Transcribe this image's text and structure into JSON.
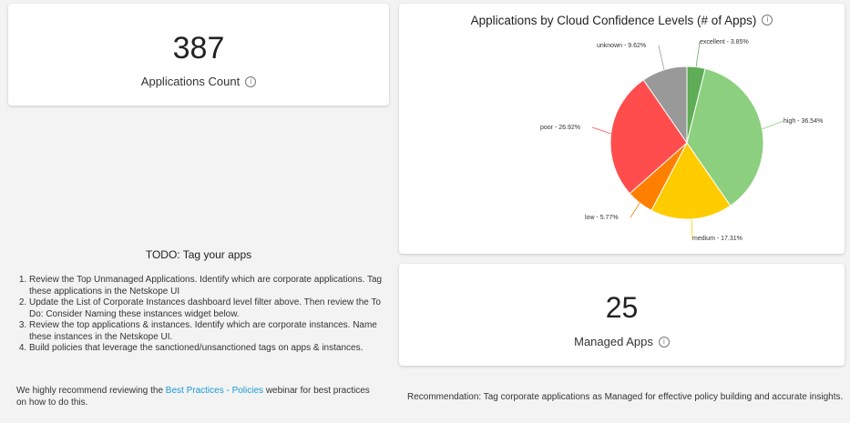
{
  "apps_count": {
    "value": "387",
    "label": "Applications Count"
  },
  "managed_apps": {
    "value": "25",
    "label": "Managed Apps"
  },
  "info_symbol": "i",
  "pie": {
    "title": "Applications by Cloud Confidence Levels (# of Apps)",
    "chart_data": {
      "type": "pie",
      "slices": [
        {
          "name": "excellent",
          "value": 3.85,
          "label": "excellent - 3.85%",
          "color": "#5fad56"
        },
        {
          "name": "high",
          "value": 36.54,
          "label": "high - 36.54%",
          "color": "#8ccf7e"
        },
        {
          "name": "medium",
          "value": 17.31,
          "label": "medium - 17.31%",
          "color": "#ffcc00"
        },
        {
          "name": "low",
          "value": 5.77,
          "label": "low - 5.77%",
          "color": "#ff8000"
        },
        {
          "name": "poor",
          "value": 26.92,
          "label": "poor - 26.92%",
          "color": "#ff4d4d"
        },
        {
          "name": "unknown",
          "value": 9.62,
          "label": "unknown - 9.62%",
          "color": "#999999"
        }
      ]
    }
  },
  "todo": {
    "title": "TODO: Tag your apps",
    "items": [
      "Review the Top Unmanaged Applications. Identify which are corporate applications. Tag these applications in the Netskope UI",
      "Update the List of Corporate Instances dashboard level filter above. Then review the To Do: Consider Naming these instances widget below.",
      "Review the top applications & instances. Identify which are corporate instances. Name these instances in the Netskope UI.",
      "Build policies that leverage the sanctioned/unsanctioned tags on apps & instances."
    ],
    "note_prefix": "We highly recommend reviewing the ",
    "note_link": "Best Practices - Policies",
    "note_suffix": " webinar for best practices on how to do this."
  },
  "recommendation": "Recommendation: Tag corporate applications as Managed for effective policy building and accurate insights."
}
